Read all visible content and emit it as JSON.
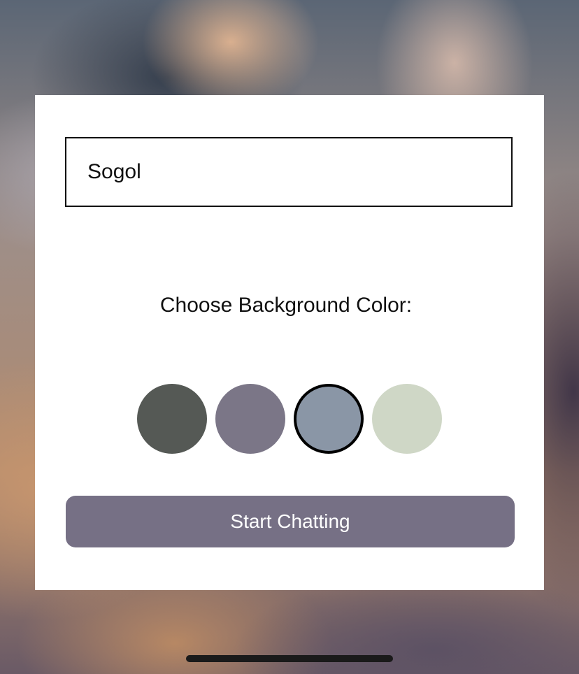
{
  "form": {
    "name_value": "Sogol",
    "color_label": "Choose Background Color:",
    "swatches": [
      {
        "color": "#555955",
        "selected": false
      },
      {
        "color": "#7b7687",
        "selected": false
      },
      {
        "color": "#8a96a6",
        "selected": true
      },
      {
        "color": "#cfd7c6",
        "selected": false
      }
    ],
    "start_button_label": "Start Chatting",
    "start_button_color": "#767085"
  }
}
